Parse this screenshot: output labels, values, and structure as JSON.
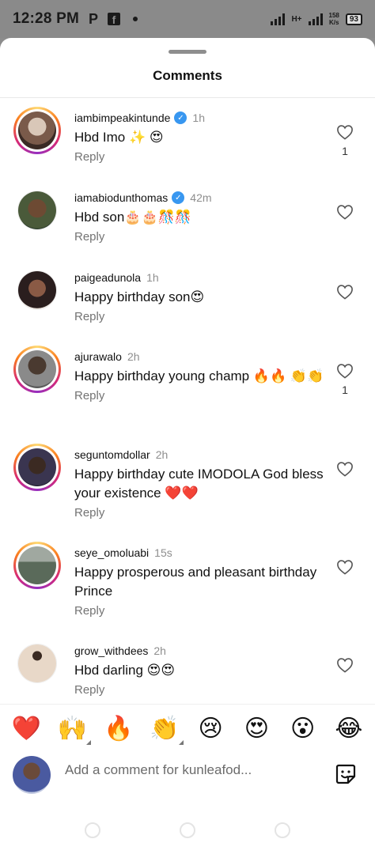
{
  "status_bar": {
    "time": "12:28 PM",
    "icons": [
      "p-app-icon",
      "facebook-icon",
      "notification-dot"
    ],
    "net_speed_value": "158",
    "net_speed_unit": "K/s",
    "network": "H+",
    "battery": "93"
  },
  "sheet": {
    "title": "Comments"
  },
  "comments": [
    {
      "username": "iambimpeakintunde",
      "verified": true,
      "time": "1h",
      "text": "Hbd Imo ✨ 😍",
      "reply": "Reply",
      "likes": "1",
      "ring": true,
      "avatar_color": "#7a5a4a"
    },
    {
      "username": "iamabiodunthomas",
      "verified": true,
      "time": "42m",
      "text": "Hbd son🎂🎂🎊🎊",
      "reply": "Reply",
      "likes": "",
      "ring": false,
      "avatar_color": "#4a5a3a"
    },
    {
      "username": "paigeadunola",
      "verified": false,
      "time": "1h",
      "text": "Happy birthday son😍",
      "reply": "Reply",
      "likes": "",
      "ring": false,
      "avatar_color": "#3a2a2a"
    },
    {
      "username": "ajurawalo",
      "verified": false,
      "time": "2h",
      "text": "Happy birthday young champ 🔥🔥 👏👏",
      "reply": "Reply",
      "likes": "1",
      "ring": true,
      "avatar_color": "#6a6a6a"
    },
    {
      "username": "seguntomdollar",
      "verified": false,
      "time": "2h",
      "text": "Happy birthday cute IMODOLA God bless your existence ❤️❤️",
      "reply": "Reply",
      "likes": "",
      "ring": true,
      "avatar_color": "#3a3550"
    },
    {
      "username": "seye_omoluabi",
      "verified": false,
      "time": "15s",
      "text": "Happy prosperous and pleasant birthday Prince",
      "reply": "Reply",
      "likes": "",
      "ring": true,
      "avatar_color": "#5a6a5a"
    },
    {
      "username": "grow_withdees",
      "verified": false,
      "time": "2h",
      "text": "Hbd darling 😍😍",
      "reply": "Reply",
      "likes": "",
      "ring": false,
      "avatar_color": "#e8d8c8"
    }
  ],
  "emoji_bar": [
    "❤️",
    "🙌",
    "🔥",
    "👏",
    "😢",
    "😍",
    "😮",
    "😂"
  ],
  "composer": {
    "placeholder": "Add a comment for kunleafod..."
  },
  "colors": {
    "verified_blue": "#3897f0",
    "ring_gradient": [
      "#feda75",
      "#fa7e1e",
      "#d62976",
      "#962fbf"
    ]
  }
}
